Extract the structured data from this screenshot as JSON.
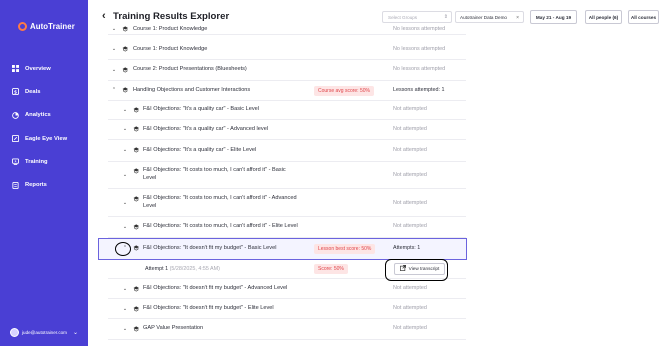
{
  "sidebar": {
    "brand": "AutoTrainer",
    "items": [
      {
        "label": "Overview",
        "icon": "grid-icon"
      },
      {
        "label": "Deals",
        "icon": "dollar-icon"
      },
      {
        "label": "Analytics",
        "icon": "chart-icon"
      },
      {
        "label": "Eagle Eye View",
        "icon": "eye-icon"
      },
      {
        "label": "Training",
        "icon": "training-icon"
      },
      {
        "label": "Reports",
        "icon": "report-icon"
      }
    ],
    "user_email": "jude@autotrainer.com"
  },
  "header": {
    "title": "Training Results Explorer",
    "groups_placeholder": "Select Groups",
    "dealer_select": "Autotrainer Data Demo",
    "date_range": "May 21 - Aug 19",
    "people_button": "All people (6)",
    "courses_button": "All courses"
  },
  "rows": [
    {
      "name": "Course 1: Product Knowledge",
      "status": "No lessons attempted",
      "level": "course",
      "expanded": false
    },
    {
      "name": "Course 1: Product Knowledge",
      "status": "No lessons attempted",
      "level": "course",
      "expanded": false
    },
    {
      "name": "Course 2: Product Presentations (Bluesheets)",
      "status": "No lessons attempted",
      "level": "course",
      "expanded": false
    },
    {
      "name": "Handling Objections and Customer Interactions",
      "badge": "Course avg score: 50%",
      "status": "Lessons attempted: 1",
      "level": "course",
      "expanded": true
    },
    {
      "name": "F&I Objections: \"It's a quality car\" - Basic Level",
      "status": "Not attempted",
      "level": "lesson"
    },
    {
      "name": "F&I Objections: \"It's a quality car\" - Advanced level",
      "status": "Not attempted",
      "level": "lesson"
    },
    {
      "name": "F&I Objections: \"It's a quality car\" - Elite Level",
      "status": "Not attempted",
      "level": "lesson"
    },
    {
      "name": "F&I Objections: \"It costs too much, I can't afford it\" - Basic Level",
      "status": "Not attempted",
      "level": "lesson"
    },
    {
      "name": "F&I Objections: \"It costs too much, I can't afford it\" - Advanced Level",
      "status": "Not attempted",
      "level": "lesson"
    },
    {
      "name": "F&I Objections: \"It costs too much, I can't afford it\" - Elite Level",
      "status": "Not attempted",
      "level": "lesson"
    },
    {
      "name": "F&I Objections: \"It doesn't fit my budget\" - Basic Level",
      "badge": "Lesson best score: 50%",
      "status": "Attempts: 1",
      "level": "lesson",
      "expanded": true
    },
    {
      "name": "F&I Objections: \"It doesn't fit my budget\" - Advanced Level",
      "status": "Not attempted",
      "level": "lesson"
    },
    {
      "name": "F&I Objections: \"It doesn't fit my budget\" - Elite Level",
      "status": "Not attempted",
      "level": "lesson"
    },
    {
      "name": "GAP Value Presentation",
      "status": "Not attempted",
      "level": "lesson"
    }
  ],
  "attempt": {
    "label": "Attempt 1",
    "date": "(5/28/2025, 4:55 AM)",
    "score": "Score: 50%",
    "transcript_button": "View transcript"
  },
  "colors": {
    "sidebar": "#4a3fd4",
    "accent": "#6b63de",
    "badge_bg": "#fde5e5",
    "badge_text": "#e0454a",
    "muted": "#a0a0ab"
  }
}
